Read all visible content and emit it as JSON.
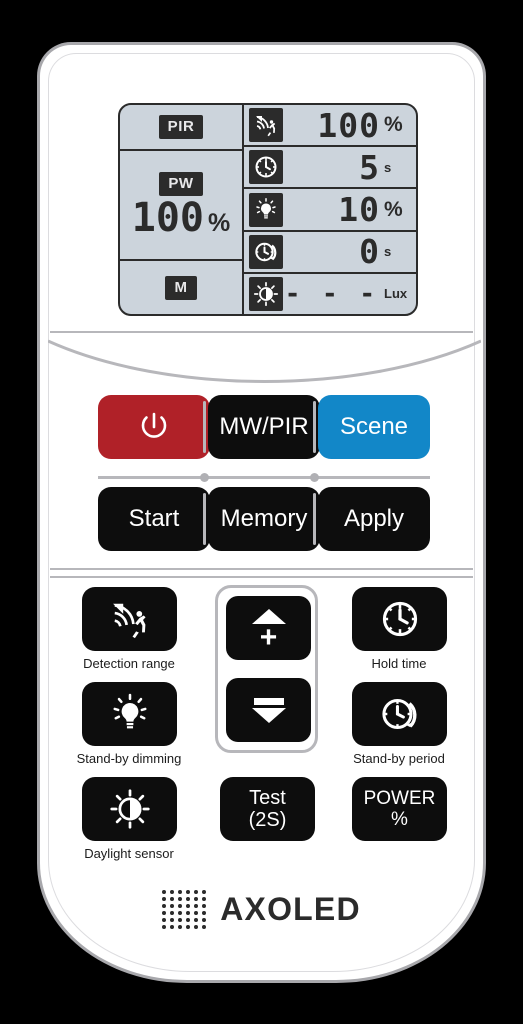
{
  "device": {
    "brand": "AXOLED"
  },
  "lcd": {
    "mode_badges": [
      {
        "name": "pir",
        "label": "PIR"
      },
      {
        "name": "pw",
        "label": "PW"
      },
      {
        "name": "m",
        "label": "M"
      }
    ],
    "power_readout": {
      "value": "100",
      "unit": "%"
    },
    "rows": [
      {
        "icon": "detection-range-icon",
        "value": "100",
        "unit": "%"
      },
      {
        "icon": "hold-time-clock-icon",
        "value": "5",
        "unit": "s"
      },
      {
        "icon": "standby-dimming-bulb-icon",
        "value": "10",
        "unit": "%"
      },
      {
        "icon": "standby-period-clock-icon",
        "value": "0",
        "unit": "s"
      },
      {
        "icon": "daylight-sensor-icon",
        "value": "- - -",
        "unit": "Lux"
      }
    ]
  },
  "top_buttons": [
    {
      "name": "power-button",
      "label": "",
      "icon": "power-icon",
      "color": "#b02128"
    },
    {
      "name": "mw-pir-button",
      "label": "MW/PIR",
      "color": "#0d0d0d"
    },
    {
      "name": "scene-button",
      "label": "Scene",
      "color": "#1287c8"
    },
    {
      "name": "start-button",
      "label": "Start",
      "color": "#0d0d0d"
    },
    {
      "name": "memory-button",
      "label": "Memory",
      "color": "#0d0d0d"
    },
    {
      "name": "apply-button",
      "label": "Apply",
      "color": "#0d0d0d"
    }
  ],
  "function_buttons": {
    "detection_range": {
      "label": "Detection range",
      "icon": "detection-range-icon"
    },
    "standby_dimming": {
      "label": "Stand-by dimming",
      "icon": "bulb-icon"
    },
    "daylight_sensor": {
      "label": "Daylight sensor",
      "icon": "daylight-sensor-icon"
    },
    "hold_time": {
      "label": "Hold time",
      "icon": "clock-icon"
    },
    "standby_period": {
      "label": "Stand-by period",
      "icon": "clock-arc-icon"
    },
    "increase": {
      "label": "+",
      "icon": "up-arrow-icon"
    },
    "decrease": {
      "label": "−",
      "icon": "down-arrow-icon"
    },
    "test": {
      "line1": "Test",
      "line2": "(2S)"
    },
    "power_percent": {
      "line1": "POWER",
      "line2": "%"
    }
  },
  "colors": {
    "accent_red": "#b02128",
    "accent_blue": "#1287c8",
    "button_black": "#0d0d0d",
    "lcd_background": "#ccd4dc",
    "body_outline": "#a8a8ac"
  }
}
